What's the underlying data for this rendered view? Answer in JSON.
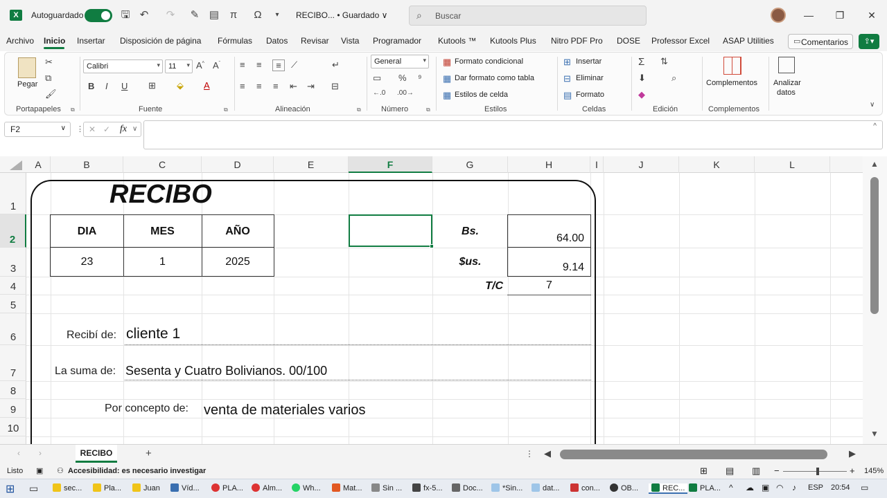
{
  "titlebar": {
    "autosave_label": "Autoguardado",
    "doc_title": "RECIBO... • Guardado ∨",
    "search_placeholder": "Buscar"
  },
  "menu": [
    "Archivo",
    "Inicio",
    "Insertar",
    "Disposición de página",
    "Fórmulas",
    "Datos",
    "Revisar",
    "Vista",
    "Programador",
    "Kutools ™",
    "Kutools Plus",
    "Nitro PDF Pro",
    "DOSE",
    "Professor Excel",
    "ASAP Utilities"
  ],
  "comments_label": "Comentarios",
  "ribbon": {
    "paste_label": "Pegar",
    "font_name": "Calibri",
    "font_size": "11",
    "number_format": "General",
    "cond_format": "Formato condicional",
    "table_format": "Dar formato como tabla",
    "cell_styles": "Estilos de celda",
    "insert": "Insertar",
    "delete": "Eliminar",
    "format": "Formato",
    "addins": "Complementos",
    "analyze": "Analizar",
    "analyze2": "datos",
    "groups": {
      "clipboard": "Portapapeles",
      "font": "Fuente",
      "alignment": "Alineación",
      "number": "Número",
      "styles": "Estilos",
      "cells": "Celdas",
      "editing": "Edición",
      "addins": "Complementos"
    }
  },
  "formula_bar": {
    "namebox": "F2",
    "fx": "fx"
  },
  "columns": [
    "A",
    "B",
    "C",
    "D",
    "E",
    "F",
    "G",
    "H",
    "I",
    "J",
    "K",
    "L"
  ],
  "rows": [
    "1",
    "2",
    "3",
    "4",
    "5",
    "6",
    "7",
    "8",
    "9",
    "10"
  ],
  "receipt": {
    "title": "RECIBO",
    "h_dia": "DIA",
    "h_mes": "MES",
    "h_anio": "AÑO",
    "dia": "23",
    "mes": "1",
    "anio": "2025",
    "bs_label": "Bs.",
    "bs_value": "64.00",
    "us_label": "$us.",
    "us_value": "9.14",
    "tc_label": "T/C",
    "tc_value": "7",
    "recibi_label": "Recibí de:",
    "recibi_value": "cliente 1",
    "suma_label": "La suma de:",
    "suma_value": "Sesenta y Cuatro Bolivianos. 00/100",
    "concepto_label": "Por concepto de:",
    "concepto_value": "venta de materiales varios"
  },
  "sheet_tab": "RECIBO",
  "status": {
    "ready": "Listo",
    "accessibility": "Accesibilidad: es necesario investigar",
    "zoom": "145%"
  },
  "taskbar": {
    "items": [
      "sec...",
      "Pla...",
      "Juan",
      "Víd...",
      "PLA...",
      "Alm...",
      "Wh...",
      "Mat...",
      "Sin ...",
      "fx-5...",
      "Doc...",
      "*Sin...",
      "dat...",
      "con...",
      "OB...",
      "REC...",
      "PLA..."
    ],
    "lang": "ESP",
    "time": "20:54"
  }
}
